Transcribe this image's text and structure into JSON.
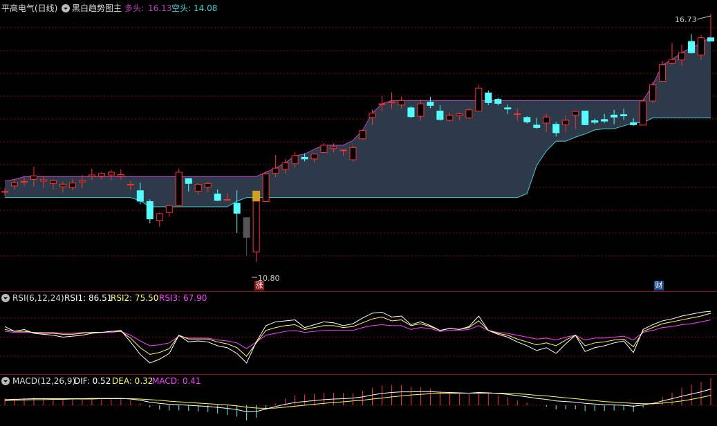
{
  "main": {
    "title": "平高电气(日线)",
    "indicator": "黑白趋势图主",
    "long_label": "多头: ",
    "long_value": "16.13",
    "short_label": "空头: ",
    "short_value": "14.08",
    "high_label": "16.73",
    "low_label": "10.80",
    "marker_zhang": "涨",
    "marker_cai": "财"
  },
  "rsi": {
    "label": "RSI(6,12,24)",
    "rsi1": "RSI1: 86.51",
    "rsi2": "RSI2: 75.50",
    "rsi3": "RSI3: 67.90"
  },
  "macd": {
    "label": "MACD(12,26,9)",
    "dif": "DIF: 0.52",
    "dea": "DEA: 0.32",
    "macd": "MACD: 0.41"
  },
  "colors": {
    "up": "#ff3232",
    "down": "#54ffff",
    "band_fill": "#2c3a4a",
    "long_color": "#c040c0",
    "short_color": "#40d0d0",
    "rsi1": "#ffffff",
    "rsi2": "#ffff60",
    "rsi3": "#ff40ff"
  },
  "chart_data": {
    "type": "candlestick",
    "ylim": [
      10.4,
      17.0
    ],
    "high": 16.73,
    "low": 10.8,
    "candles": [
      [
        12.54,
        12.63,
        12.44,
        12.55
      ],
      [
        12.69,
        12.83,
        12.6,
        12.77
      ],
      [
        12.79,
        12.9,
        12.69,
        12.8
      ],
      [
        12.85,
        13.17,
        12.67,
        12.94
      ],
      [
        12.81,
        12.94,
        12.64,
        12.84
      ],
      [
        12.75,
        12.85,
        12.6,
        12.82
      ],
      [
        12.67,
        12.79,
        12.53,
        12.73
      ],
      [
        12.65,
        12.86,
        12.58,
        12.76
      ],
      [
        12.79,
        12.96,
        12.63,
        12.82
      ],
      [
        12.92,
        13.12,
        12.83,
        12.96
      ],
      [
        12.93,
        13.04,
        12.85,
        13.0
      ],
      [
        12.96,
        13.09,
        12.83,
        13.03
      ],
      [
        12.93,
        13.1,
        12.85,
        12.97
      ],
      [
        12.73,
        12.81,
        12.58,
        12.73
      ],
      [
        12.57,
        12.77,
        12.23,
        12.31
      ],
      [
        12.3,
        12.35,
        11.76,
        11.87
      ],
      [
        11.83,
        12.03,
        11.68,
        12.0
      ],
      [
        12.03,
        12.23,
        11.92,
        12.2
      ],
      [
        12.2,
        13.12,
        12.17,
        13.03
      ],
      [
        12.87,
        12.87,
        12.55,
        12.75
      ],
      [
        12.56,
        12.76,
        12.47,
        12.73
      ],
      [
        12.66,
        12.79,
        12.53,
        12.75
      ],
      [
        12.49,
        12.6,
        12.31,
        12.33
      ],
      [
        12.33,
        12.51,
        12.31,
        12.35
      ],
      [
        12.26,
        12.58,
        11.52,
        12.01
      ],
      [
        11.9,
        11.9,
        10.95,
        11.41
      ],
      [
        11.05,
        12.31,
        10.8,
        12.31
      ],
      [
        12.3,
        13.05,
        12.3,
        12.99
      ],
      [
        13.0,
        13.45,
        12.91,
        13.13
      ],
      [
        13.1,
        13.35,
        12.99,
        13.26
      ],
      [
        13.24,
        13.53,
        13.14,
        13.44
      ],
      [
        13.4,
        13.5,
        13.3,
        13.36
      ],
      [
        13.36,
        13.5,
        13.28,
        13.48
      ],
      [
        13.52,
        13.75,
        13.5,
        13.7
      ],
      [
        13.62,
        13.75,
        13.52,
        13.66
      ],
      [
        13.58,
        13.6,
        13.44,
        13.58
      ],
      [
        13.34,
        13.7,
        13.3,
        13.64
      ],
      [
        13.86,
        14.1,
        13.83,
        14.07
      ],
      [
        14.39,
        14.58,
        14.2,
        14.5
      ],
      [
        14.71,
        14.92,
        14.53,
        14.73
      ],
      [
        14.76,
        15.02,
        14.6,
        14.78
      ],
      [
        14.7,
        14.9,
        14.61,
        14.81
      ],
      [
        14.63,
        14.67,
        14.37,
        14.41
      ],
      [
        14.42,
        14.83,
        14.31,
        14.73
      ],
      [
        14.77,
        14.9,
        14.62,
        14.69
      ],
      [
        14.55,
        14.7,
        14.31,
        14.34
      ],
      [
        14.32,
        14.51,
        14.28,
        14.44
      ],
      [
        14.44,
        14.51,
        14.32,
        14.48
      ],
      [
        14.38,
        14.62,
        14.35,
        14.58
      ],
      [
        14.55,
        15.2,
        14.57,
        15.12
      ],
      [
        15.0,
        15.06,
        14.7,
        14.76
      ],
      [
        14.84,
        14.88,
        14.69,
        14.74
      ],
      [
        14.63,
        14.71,
        14.48,
        14.6
      ],
      [
        14.48,
        14.62,
        14.31,
        14.48
      ],
      [
        14.39,
        14.42,
        14.24,
        14.28
      ],
      [
        14.2,
        14.38,
        14.11,
        14.14
      ],
      [
        14.25,
        14.48,
        14.03,
        14.4
      ],
      [
        14.22,
        14.28,
        13.92,
        14.01
      ],
      [
        14.21,
        14.44,
        14.02,
        14.32
      ],
      [
        14.45,
        14.55,
        14.1,
        14.54
      ],
      [
        14.55,
        14.55,
        14.22,
        14.21
      ],
      [
        14.31,
        14.36,
        14.22,
        14.27
      ],
      [
        14.34,
        14.48,
        14.25,
        14.3
      ],
      [
        14.45,
        14.58,
        14.22,
        14.4
      ],
      [
        14.46,
        14.6,
        14.33,
        14.43
      ],
      [
        14.26,
        14.37,
        14.18,
        14.21
      ],
      [
        14.2,
        14.85,
        14.2,
        14.8
      ],
      [
        14.8,
        15.28,
        14.75,
        15.2
      ],
      [
        15.29,
        15.8,
        15.27,
        15.7
      ],
      [
        15.74,
        16.24,
        15.7,
        15.83
      ],
      [
        15.82,
        16.2,
        15.68,
        16.0
      ],
      [
        16.28,
        16.46,
        15.98,
        16.0
      ],
      [
        15.94,
        16.43,
        15.82,
        16.37
      ],
      [
        16.37,
        16.73,
        16.32,
        16.29
      ]
    ],
    "long_line": [
      12.81,
      12.85,
      12.92,
      12.92,
      12.92,
      12.92,
      12.92,
      12.92,
      12.92,
      12.92,
      12.92,
      12.92,
      12.92,
      12.92,
      12.92,
      12.92,
      12.92,
      12.92,
      12.92,
      12.92,
      12.92,
      12.92,
      12.92,
      12.92,
      12.92,
      12.92,
      12.92,
      13.03,
      13.13,
      13.26,
      13.44,
      13.48,
      13.6,
      13.7,
      13.7,
      13.7,
      13.82,
      14.07,
      14.5,
      14.73,
      14.81,
      14.81,
      14.81,
      14.81,
      14.81,
      14.81,
      14.81,
      14.81,
      14.81,
      14.81,
      14.81,
      14.81,
      14.81,
      14.81,
      14.81,
      14.81,
      14.81,
      14.81,
      14.81,
      14.81,
      14.81,
      14.81,
      14.81,
      14.81,
      14.81,
      14.81,
      14.81,
      15.2,
      15.7,
      15.83,
      16.0,
      16.13,
      16.23,
      16.4
    ],
    "short_line": [
      12.4,
      12.4,
      12.4,
      12.4,
      12.4,
      12.4,
      12.4,
      12.4,
      12.4,
      12.4,
      12.4,
      12.4,
      12.4,
      12.4,
      12.32,
      12.17,
      12.17,
      12.17,
      12.17,
      12.17,
      12.17,
      12.17,
      12.17,
      12.17,
      12.31,
      12.4,
      12.4,
      12.4,
      12.4,
      12.4,
      12.4,
      12.4,
      12.4,
      12.4,
      12.4,
      12.4,
      12.4,
      12.4,
      12.4,
      12.4,
      12.4,
      12.4,
      12.4,
      12.4,
      12.4,
      12.4,
      12.4,
      12.4,
      12.4,
      12.4,
      12.4,
      12.4,
      12.4,
      12.4,
      12.5,
      13.2,
      13.56,
      13.8,
      13.8,
      13.9,
      13.98,
      14.08,
      14.11,
      14.11,
      14.18,
      14.26,
      14.26,
      14.38,
      14.38,
      14.38,
      14.38,
      14.38,
      14.38,
      14.38
    ],
    "rsi1": [
      61,
      56,
      58,
      54,
      53,
      52,
      50,
      51,
      52,
      54,
      55,
      56,
      57,
      45,
      32,
      23,
      27,
      33,
      52,
      45,
      46,
      45,
      41,
      39,
      33,
      23,
      45,
      62,
      66,
      67,
      68,
      60,
      63,
      66,
      65,
      62,
      64,
      70,
      75,
      76,
      71,
      72,
      63,
      66,
      62,
      57,
      59,
      58,
      61,
      72,
      57,
      53,
      50,
      45,
      41,
      36,
      39,
      33,
      43,
      52,
      35,
      39,
      41,
      44,
      46,
      34,
      58,
      63,
      67,
      69,
      72,
      74,
      76,
      77
    ],
    "rsi2": [
      58,
      56,
      56,
      55,
      54,
      54,
      53,
      53,
      54,
      55,
      55,
      56,
      56,
      49,
      39,
      32,
      34,
      38,
      52,
      48,
      48,
      48,
      45,
      43,
      39,
      30,
      44,
      57,
      60,
      62,
      63,
      58,
      60,
      62,
      62,
      60,
      61,
      65,
      69,
      71,
      67,
      68,
      62,
      64,
      61,
      57,
      59,
      58,
      60,
      67,
      57,
      54,
      52,
      48,
      45,
      42,
      44,
      41,
      47,
      52,
      41,
      44,
      45,
      47,
      48,
      40,
      56,
      60,
      64,
      66,
      68,
      70,
      72,
      75
    ],
    "rsi3": [
      56,
      55,
      55,
      55,
      55,
      55,
      54,
      54,
      55,
      55,
      55,
      55,
      56,
      52,
      46,
      41,
      42,
      44,
      51,
      49,
      49,
      49,
      47,
      46,
      44,
      38,
      45,
      52,
      54,
      56,
      57,
      55,
      56,
      57,
      57,
      57,
      57,
      60,
      62,
      63,
      62,
      62,
      58,
      60,
      59,
      56,
      57,
      57,
      58,
      62,
      57,
      55,
      54,
      52,
      50,
      48,
      49,
      47,
      50,
      52,
      47,
      49,
      49,
      50,
      51,
      47,
      55,
      57,
      60,
      61,
      63,
      64,
      66,
      68
    ],
    "dif": [
      0.18,
      0.19,
      0.2,
      0.21,
      0.21,
      0.21,
      0.21,
      0.21,
      0.21,
      0.22,
      0.22,
      0.22,
      0.22,
      0.2,
      0.16,
      0.1,
      0.06,
      0.03,
      0.02,
      0.0,
      -0.02,
      -0.04,
      -0.07,
      -0.1,
      -0.14,
      -0.21,
      -0.2,
      -0.12,
      -0.04,
      0.03,
      0.09,
      0.12,
      0.15,
      0.18,
      0.2,
      0.21,
      0.23,
      0.27,
      0.33,
      0.38,
      0.41,
      0.43,
      0.43,
      0.44,
      0.44,
      0.42,
      0.41,
      0.4,
      0.39,
      0.41,
      0.4,
      0.38,
      0.35,
      0.31,
      0.27,
      0.22,
      0.19,
      0.14,
      0.12,
      0.1,
      0.06,
      0.04,
      0.02,
      0.01,
      0.0,
      -0.03,
      0.01,
      0.06,
      0.14,
      0.21,
      0.29,
      0.36,
      0.43,
      0.52
    ],
    "dea": [
      0.15,
      0.16,
      0.17,
      0.18,
      0.18,
      0.19,
      0.19,
      0.2,
      0.2,
      0.2,
      0.21,
      0.21,
      0.21,
      0.21,
      0.2,
      0.18,
      0.16,
      0.13,
      0.11,
      0.09,
      0.07,
      0.05,
      0.03,
      0.01,
      -0.02,
      -0.06,
      -0.09,
      -0.1,
      -0.09,
      -0.06,
      -0.03,
      0.0,
      0.03,
      0.06,
      0.09,
      0.11,
      0.14,
      0.16,
      0.2,
      0.23,
      0.27,
      0.3,
      0.33,
      0.35,
      0.37,
      0.38,
      0.38,
      0.39,
      0.39,
      0.39,
      0.39,
      0.39,
      0.38,
      0.37,
      0.35,
      0.32,
      0.3,
      0.27,
      0.24,
      0.21,
      0.18,
      0.15,
      0.12,
      0.1,
      0.08,
      0.06,
      0.05,
      0.05,
      0.07,
      0.1,
      0.14,
      0.19,
      0.25,
      0.32
    ]
  }
}
